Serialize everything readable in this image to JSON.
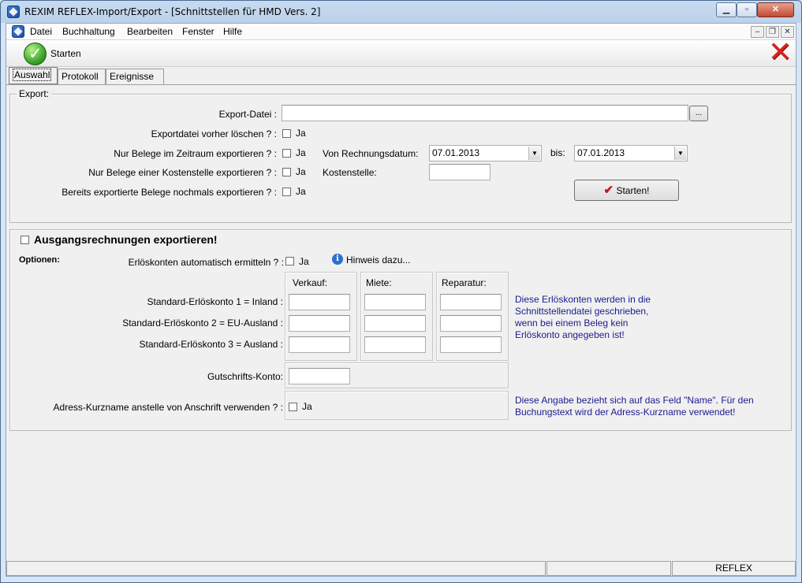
{
  "window": {
    "title": "REXIM REFLEX-Import/Export - [Schnittstellen für HMD Vers. 2]"
  },
  "menu": [
    "Datei",
    "Buchhaltung",
    "Bearbeiten",
    "Fenster",
    "Hilfe"
  ],
  "toolbar": {
    "start_label": "Starten"
  },
  "tabs": [
    "Auswahl",
    "Protokoll",
    "Ereignisse"
  ],
  "export": {
    "group_label": "Export:",
    "file_label": "Export-Datei :",
    "file_value": "",
    "browse_label": "...",
    "delete_label": "Exportdatei vorher löschen ? :",
    "period_label": "Nur Belege im Zeitraum exportieren ? :",
    "cost_label": "Nur Belege einer Kostenstelle exportieren ? :",
    "again_label": "Bereits exportierte Belege nochmals exportieren ? :",
    "ja": "Ja",
    "from_label": "Von Rechnungsdatum:",
    "from_value": "07.01.2013",
    "to_label": "bis:",
    "to_value": "07.01.2013",
    "cost_center_label": "Kostenstelle:",
    "cost_center_value": "",
    "start_button": "Starten!"
  },
  "outgoing": {
    "title": "Ausgangsrechnungen exportieren!",
    "options_label": "Optionen:",
    "auto_label": "Erlöskonten automatisch ermitteln ? :",
    "ja": "Ja",
    "hint_label": "Hinweis dazu...",
    "col_headers": [
      "Verkauf:",
      "Miete:",
      "Reparatur:"
    ],
    "rows": [
      "Standard-Erlöskonto 1 = Inland :",
      "Standard-Erlöskonto 2 = EU-Ausland :",
      "Standard-Erlöskonto 3 = Ausland :"
    ],
    "note1": [
      "Diese Erlöskonten werden in die",
      "Schnittstellendatei geschrieben,",
      "wenn bei einem Beleg kein",
      "Erlöskonto angegeben ist!"
    ],
    "credit_label": "Gutschrifts-Konto:",
    "short_label": "Adress-Kurzname anstelle von Anschrift verwenden ? :",
    "note2": [
      "Diese Angabe bezieht sich auf das Feld \"Name\". Für den",
      "Buchungstext wird der Adress-Kurzname verwendet!"
    ]
  },
  "status": {
    "right": "REFLEX"
  }
}
